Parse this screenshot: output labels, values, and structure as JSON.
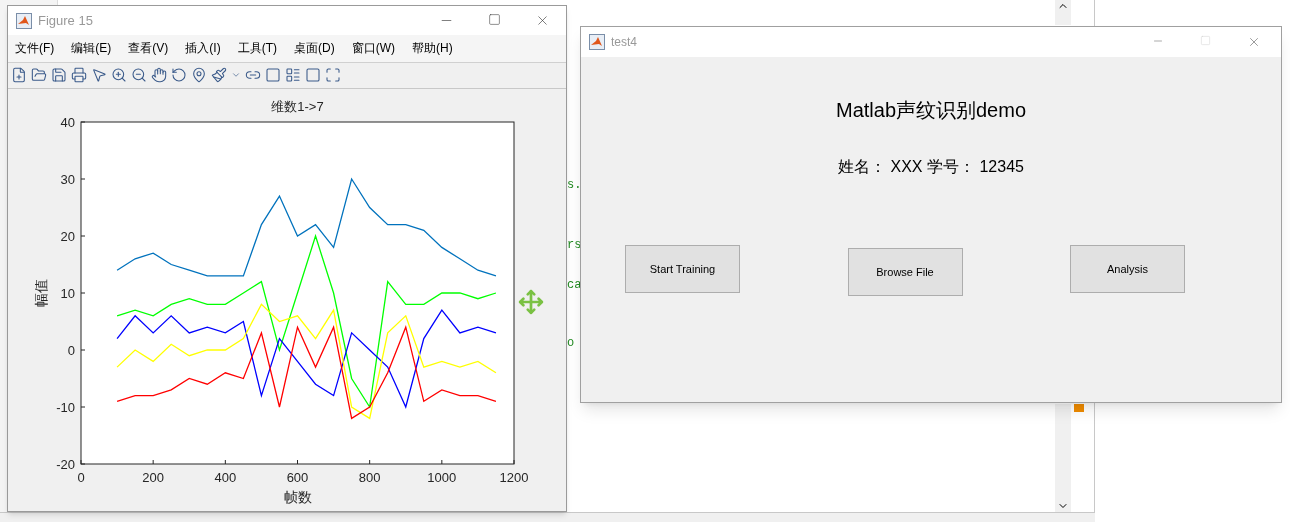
{
  "editor": {
    "fragments": [
      "s.",
      "rs",
      "ca",
      "o"
    ]
  },
  "figure": {
    "title": "Figure 15",
    "menus": [
      "文件(F)",
      "编辑(E)",
      "查看(V)",
      "插入(I)",
      "工具(T)",
      "桌面(D)",
      "窗口(W)",
      "帮助(H)"
    ],
    "chart_data": {
      "type": "line",
      "title": "维数1->7",
      "xlabel": "帧数",
      "ylabel": "幅值",
      "x": [
        100,
        150,
        200,
        250,
        300,
        350,
        400,
        450,
        500,
        550,
        600,
        650,
        700,
        750,
        800,
        850,
        900,
        950,
        1000,
        1050,
        1100,
        1150
      ],
      "xlim": [
        0,
        1200
      ],
      "ylim": [
        -20,
        40
      ],
      "xticks": [
        0,
        200,
        400,
        600,
        800,
        1000,
        1200
      ],
      "yticks": [
        -20,
        -10,
        0,
        10,
        20,
        30,
        40
      ],
      "series": [
        {
          "color": "#0072bd",
          "values": [
            14,
            16,
            17,
            15,
            14,
            13,
            13,
            13,
            22,
            27,
            20,
            22,
            18,
            30,
            25,
            22,
            22,
            21,
            18,
            16,
            14,
            13
          ]
        },
        {
          "color": "#00ff00",
          "values": [
            6,
            7,
            6,
            8,
            9,
            8,
            8,
            10,
            12,
            0,
            10,
            20,
            10,
            -5,
            -10,
            12,
            8,
            8,
            10,
            10,
            9,
            10
          ]
        },
        {
          "color": "#0000ff",
          "values": [
            2,
            6,
            3,
            6,
            3,
            4,
            3,
            5,
            -8,
            2,
            -2,
            -6,
            -8,
            3,
            0,
            -3,
            -10,
            2,
            7,
            3,
            4,
            3
          ]
        },
        {
          "color": "#ffff00",
          "values": [
            -3,
            0,
            -2,
            1,
            -1,
            0,
            0,
            2,
            8,
            5,
            6,
            2,
            7,
            -10,
            -12,
            3,
            6,
            -3,
            -2,
            -3,
            -2,
            -4
          ]
        },
        {
          "color": "#ff0000",
          "values": [
            -9,
            -8,
            -8,
            -7,
            -5,
            -6,
            -4,
            -5,
            3,
            -10,
            4,
            -3,
            4,
            -12,
            -10,
            -4,
            4,
            -9,
            -7,
            -8,
            -8,
            -9
          ]
        }
      ]
    }
  },
  "gui": {
    "title": "test4",
    "heading": "Matlab声纹识别demo",
    "info": "姓名： XXX 学号： 12345",
    "buttons": [
      "Start Training",
      "Browse File",
      "Analysis"
    ]
  }
}
